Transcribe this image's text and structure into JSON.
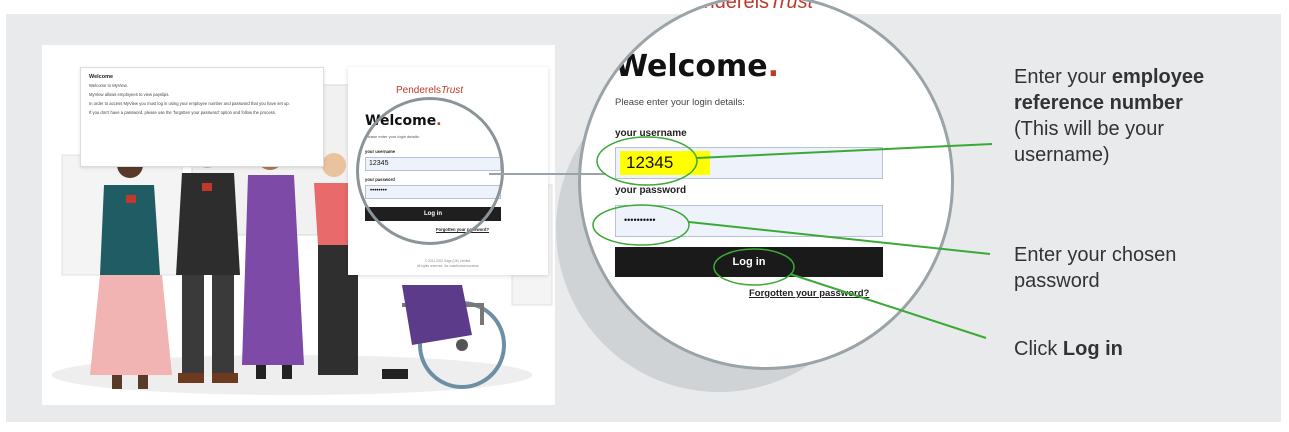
{
  "left_screenshot": {
    "welcome_box": {
      "title": "Welcome",
      "line1": "Welcome to MyView.",
      "line2": "MyView allows employees to view payslips.",
      "line3": "In order to access MyView you must log in using your employee number and password that you have set up.",
      "line4": "If you don't have a password, please use the 'forgotten your password' option and follow the process."
    },
    "login_card": {
      "logo_part1": "Penderels",
      "logo_part2": "Trust",
      "welcome": "Welcome",
      "welcome_dot": ".",
      "subtitle": "Please enter your login details:",
      "username_label": "your username",
      "username_value": "12345",
      "password_label": "your password",
      "password_value": "••••••••",
      "login_button": "Log in",
      "forgot_link": "Forgotten your password?",
      "footer1": "© 2011-2022 Sage (UK) Limited.",
      "footer2": "All rights reserved. No unauthorised access."
    }
  },
  "zoom": {
    "logo_part1": "Penderels",
    "logo_part2": "Trust",
    "welcome": "Welcome",
    "welcome_dot": ".",
    "subtitle": "Please enter your login details:",
    "username_label": "your username",
    "username_value": "12345",
    "password_label": "your password",
    "password_value": "••••••••••",
    "login_button": "Log in",
    "forgot_link": "Forgotten your password?"
  },
  "annotations": {
    "username_pre": "Enter your ",
    "username_bold1": "employee",
    "username_bold2": "reference number",
    "username_line3": "(This will be your",
    "username_line4": "username)",
    "password_line1": "Enter your chosen",
    "password_line2": "password",
    "login_pre": "Click ",
    "login_bold": "Log in"
  },
  "colors": {
    "panel_bg": "#e8eaec",
    "brand_red": "#c0392b",
    "callout_green": "#3aaa35",
    "highlight_yellow": "#ffff00",
    "button_dark": "#1a1a1a"
  }
}
